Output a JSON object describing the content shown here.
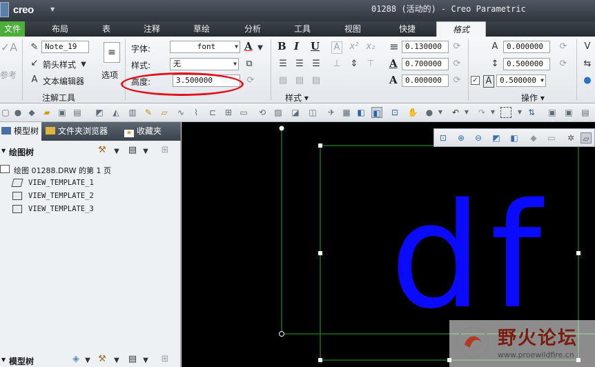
{
  "app": {
    "logo": "creo",
    "window_title": "01288 (活动的) - Creo Parametric"
  },
  "tabs": [
    {
      "label": "文件"
    },
    {
      "label": "布局"
    },
    {
      "label": "表"
    },
    {
      "label": "注释"
    },
    {
      "label": "草绘"
    },
    {
      "label": "分析"
    },
    {
      "label": "工具"
    },
    {
      "label": "视图"
    },
    {
      "label": "快捷"
    },
    {
      "label": "格式"
    }
  ],
  "ribbon": {
    "annotation_group": {
      "note_name": "Note_19",
      "partial_label_1": "参考",
      "arrow_style": "箭头样式",
      "text_editor": "文本编辑器",
      "options": "选项",
      "group_label": "注解工具"
    },
    "text_group": {
      "font_label": "字体:",
      "font_value": "font",
      "style_label": "样式:",
      "style_value": "无",
      "height_label": "高度:",
      "height_value": "3.500000"
    },
    "style_group": {
      "value_1": "0.130000",
      "value_2": "0.700000",
      "value_3": "0.000000",
      "group_label": "样式"
    },
    "operation_group": {
      "value_1": "0.000000",
      "value_2": "0.500000",
      "value_3": "0.500000",
      "group_label": "操作"
    }
  },
  "left_panel": {
    "tabs": [
      "模型树",
      "文件夹浏览器",
      "收藏夹"
    ],
    "section_title": "绘图树",
    "tree_root": "绘图 01288.DRW 的第 1 页",
    "tree_items": [
      "VIEW_TEMPLATE_1",
      "VIEW_TEMPLATE_2",
      "VIEW_TEMPLATE_3"
    ],
    "bottom_section_title": "模型树"
  },
  "canvas": {
    "note_text": "df",
    "text_color": "#0a0aff",
    "frame_color": "#26a626"
  },
  "watermark": {
    "title": "野火论坛",
    "url": "www.proewildfire.cn"
  },
  "colors": {
    "file_tab": "#4caf3a",
    "highlight_oval": "#e0141e"
  }
}
